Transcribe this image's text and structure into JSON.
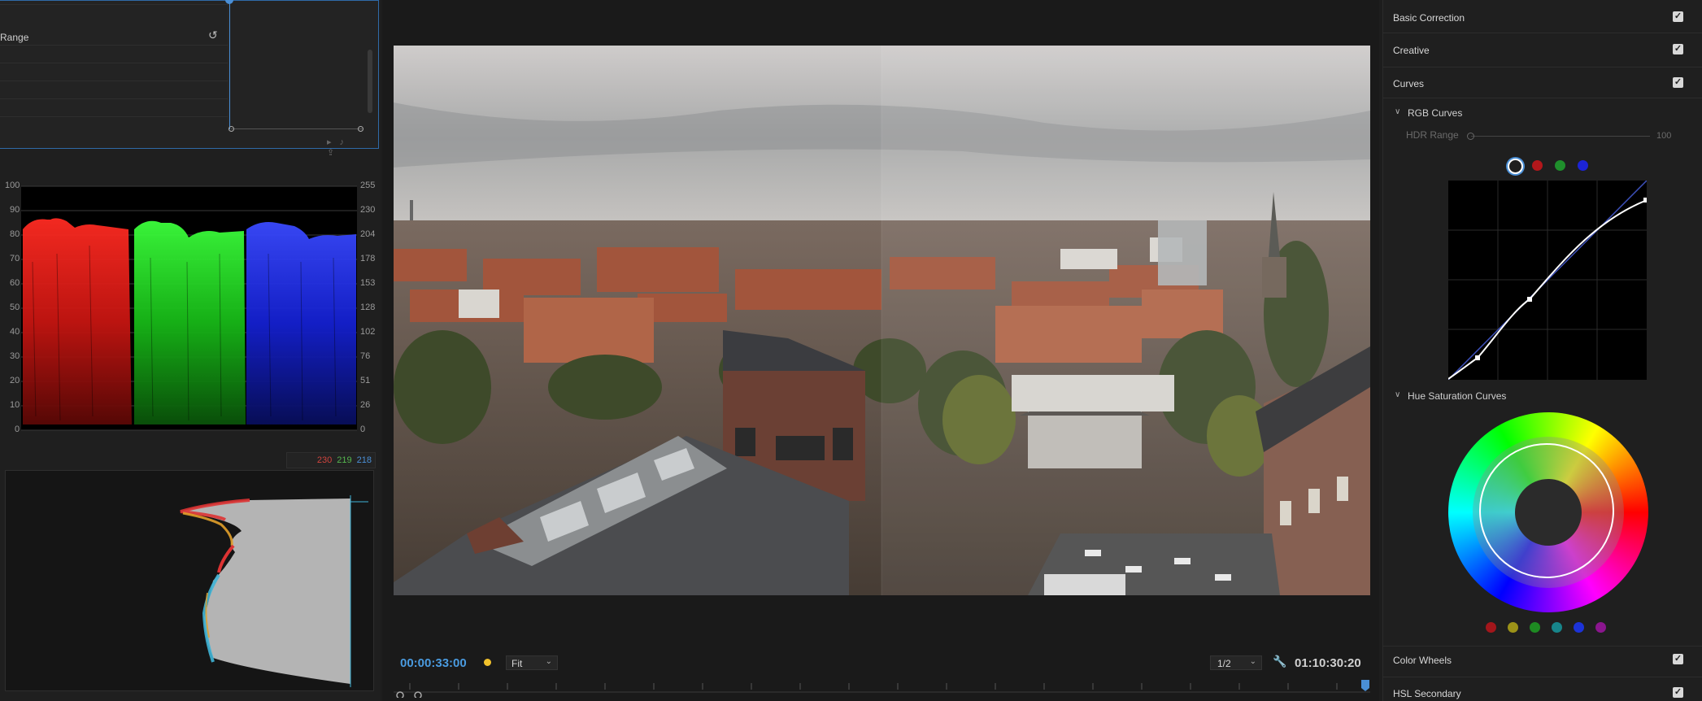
{
  "effect_controls": {
    "range_label": "Range",
    "reset_icon": "reset-icon"
  },
  "parade": {
    "left_axis": [
      "100",
      "90",
      "80",
      "70",
      "60",
      "50",
      "40",
      "30",
      "20",
      "10",
      "0"
    ],
    "right_axis": [
      "255",
      "230",
      "204",
      "178",
      "153",
      "128",
      "102",
      "76",
      "51",
      "26",
      "0"
    ],
    "colors": {
      "red": "#e8231e",
      "green": "#22d622",
      "blue": "#1f33ff"
    }
  },
  "histogram": {
    "r_value": "230",
    "g_value": "219",
    "b_value": "218"
  },
  "monitor": {
    "timecode_current": "00:00:33:00",
    "zoom": "Fit",
    "resolution": "1/2",
    "timecode_duration": "01:10:30:20",
    "marker_color": "#f2c22c"
  },
  "lumetri": {
    "sections": {
      "basic_correction": "Basic Correction",
      "creative": "Creative",
      "curves": "Curves",
      "color_wheels": "Color Wheels",
      "hsl_secondary": "HSL Secondary"
    },
    "rgb_curves": {
      "label": "RGB Curves",
      "hdr_range_label": "HDR Range",
      "hdr_range_value": "100",
      "channels": [
        "#ffffff",
        "#b3171b",
        "#1f8f2c",
        "#1c24d6"
      ]
    },
    "hue_sat": {
      "label": "Hue Saturation Curves",
      "swatches": [
        "#a3161b",
        "#9c9218",
        "#1e8a22",
        "#17858a",
        "#1c33d8",
        "#8b168e"
      ]
    }
  }
}
